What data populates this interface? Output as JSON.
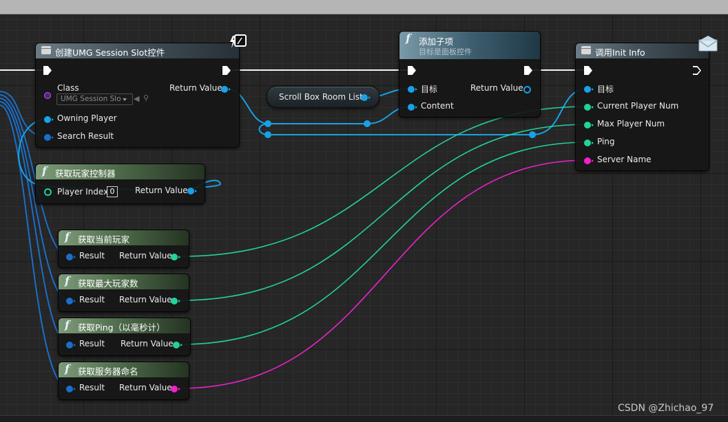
{
  "watermark": "CSDN @Zhichao_97",
  "create_node": {
    "title": "创建UMG Session Slot控件",
    "class_label": "Class",
    "class_value": "UMG Session Slo",
    "return_label": "Return Value",
    "owning_label": "Owning Player",
    "search_label": "Search Result"
  },
  "variable_node": {
    "label": "Scroll Box Room List"
  },
  "add_child_node": {
    "title": "添加子项",
    "subtitle": "目标是面板控件",
    "target_label": "目标",
    "return_label": "Return Value",
    "content_label": "Content"
  },
  "init_node": {
    "title": "调用Init Info",
    "target_label": "目标",
    "pins": [
      "Current Player Num",
      "Max Player Num",
      "Ping",
      "Server Name"
    ]
  },
  "get_controller_node": {
    "title": "获取玩家控制器",
    "index_label": "Player Index",
    "index_value": "0",
    "return_label": "Return Value"
  },
  "pure_nodes": [
    {
      "title": "获取当前玩家",
      "input_label": "Result",
      "return_label": "Return Value"
    },
    {
      "title": "获取最大玩家数",
      "input_label": "Result",
      "return_label": "Return Value"
    },
    {
      "title": "获取Ping（以毫秒计）",
      "input_label": "Result",
      "return_label": "Return Value"
    },
    {
      "title": "获取服务器命名",
      "input_label": "Result",
      "return_label": "Return Value"
    }
  ],
  "colors": {
    "exec": "#ffffff",
    "object_pin": "#17a2e8",
    "struct_pin": "#1b6ec9",
    "int_pin": "#22d29d",
    "string_pin": "#ee22cc"
  },
  "icons": {
    "call_node": "function-page-icon",
    "pure_node": "function-f-icon",
    "network_badge": "lightning-monitor-icon",
    "event_badge": "envelope-icon"
  }
}
